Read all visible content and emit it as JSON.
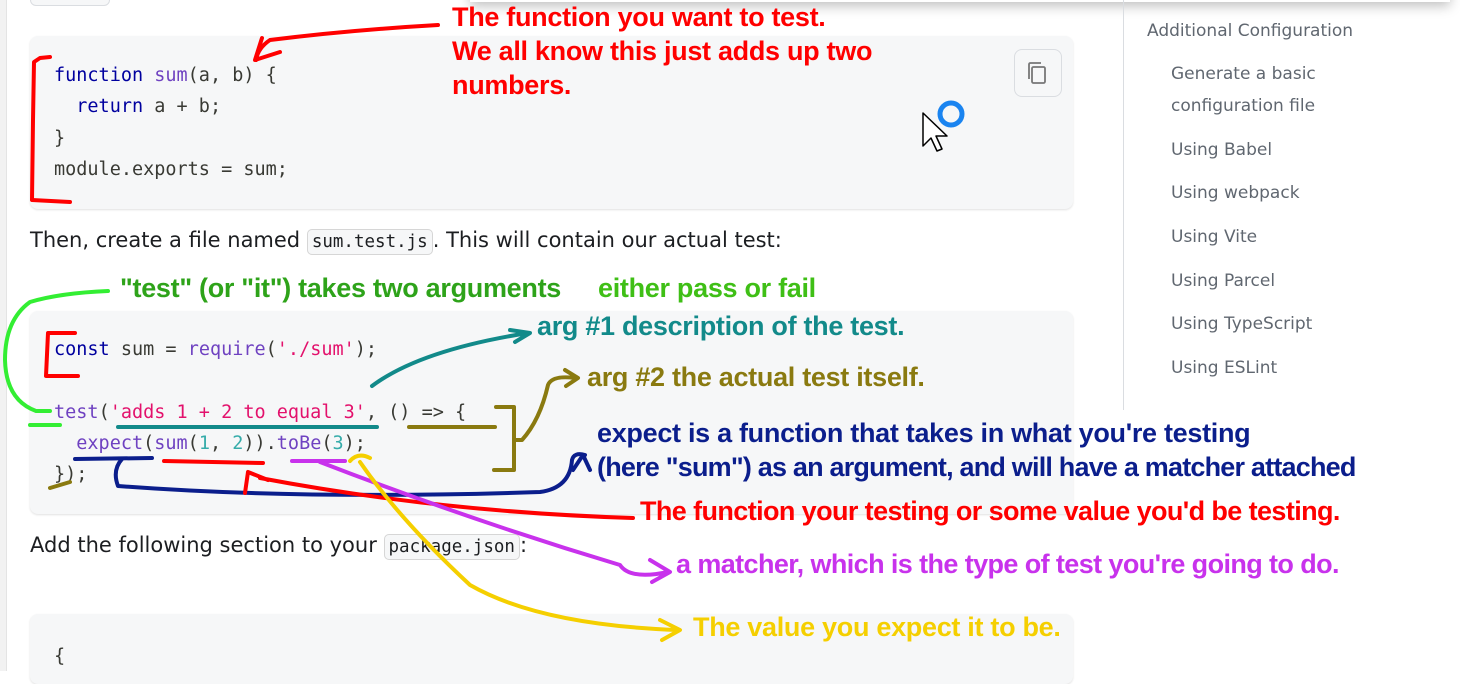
{
  "code_block_1": {
    "lines": [
      [
        {
          "t": "function",
          "c": "kw"
        },
        {
          "t": " "
        },
        {
          "t": "sum",
          "c": "fn"
        },
        {
          "t": "(a, b) {",
          "c": "p"
        }
      ],
      [
        {
          "t": "  "
        },
        {
          "t": "return",
          "c": "kw"
        },
        {
          "t": " a "
        },
        {
          "t": "+",
          "c": "op"
        },
        {
          "t": " b;"
        }
      ],
      [
        {
          "t": "}",
          "c": "p"
        }
      ],
      [
        {
          "t": "module.exports "
        },
        {
          "t": "=",
          "c": "op"
        },
        {
          "t": " sum;"
        }
      ]
    ]
  },
  "paragraph_1": {
    "before": "Then, create a file named ",
    "code": "sum.test.js",
    "after": ". This will contain our actual test:"
  },
  "code_block_2": {
    "lines": [
      [
        {
          "t": "const",
          "c": "kw"
        },
        {
          "t": " sum "
        },
        {
          "t": "=",
          "c": "op"
        },
        {
          "t": " "
        },
        {
          "t": "require",
          "c": "fn"
        },
        {
          "t": "(",
          "c": "p"
        },
        {
          "t": "'./sum'",
          "c": "str"
        },
        {
          "t": ");",
          "c": "p"
        }
      ],
      [
        {
          "t": ""
        }
      ],
      [
        {
          "t": "test",
          "c": "fn"
        },
        {
          "t": "(",
          "c": "p"
        },
        {
          "t": "'adds 1 + 2 to equal 3'",
          "c": "str"
        },
        {
          "t": ", () "
        },
        {
          "t": "=>",
          "c": "op"
        },
        {
          "t": " {"
        }
      ],
      [
        {
          "t": "  "
        },
        {
          "t": "expect",
          "c": "fn"
        },
        {
          "t": "(",
          "c": "p"
        },
        {
          "t": "sum",
          "c": "fn"
        },
        {
          "t": "(",
          "c": "p"
        },
        {
          "t": "1",
          "c": "num"
        },
        {
          "t": ", "
        },
        {
          "t": "2",
          "c": "num"
        },
        {
          "t": "))."
        },
        {
          "t": "toBe",
          "c": "fn"
        },
        {
          "t": "(",
          "c": "p"
        },
        {
          "t": "3",
          "c": "num"
        },
        {
          "t": ");",
          "c": "p"
        }
      ],
      [
        {
          "t": "});",
          "c": "p"
        }
      ]
    ]
  },
  "paragraph_2": {
    "before": "Add the following section to your ",
    "code": "package.json",
    "after": ":"
  },
  "code_block_3": {
    "first_line": "{"
  },
  "toc": {
    "items": [
      "Additional Configuration",
      "Generate a basic",
      "configuration file",
      "Using Babel",
      "Using webpack",
      "Using Vite",
      "Using Parcel",
      "Using TypeScript",
      "Using ESLint"
    ]
  },
  "annotations": {
    "function_note_1": "The function you want to test.",
    "function_note_2": "We all know this just adds up two",
    "function_note_3": "numbers.",
    "test_args": "\"test\" (or \"it\") takes two arguments",
    "pass_fail": "either pass or fail",
    "arg1": "arg #1 description of the test.",
    "arg2": "arg #2 the actual test itself.",
    "expect_1": "expect is a function that takes in what you're testing",
    "expect_2": "(here \"sum\") as an argument, and will have a matcher attached",
    "function_testing": "The function your testing or some value you'd be testing.",
    "matcher": "a matcher, which is the type of test you're going to do.",
    "value": "The value you expect it to be."
  },
  "colors": {
    "red": "#ff0000",
    "green": "#2ea31a",
    "lime": "#33ee33",
    "teal": "#128a8a",
    "olive": "#8a7a10",
    "navy": "#0b1e8c",
    "magenta": "#c832ec",
    "yellow": "#f5cf00"
  },
  "icons": {
    "copy": "copy-icon",
    "cursor": "mouse-pointer-icon",
    "loading": "loading-ring-icon"
  }
}
